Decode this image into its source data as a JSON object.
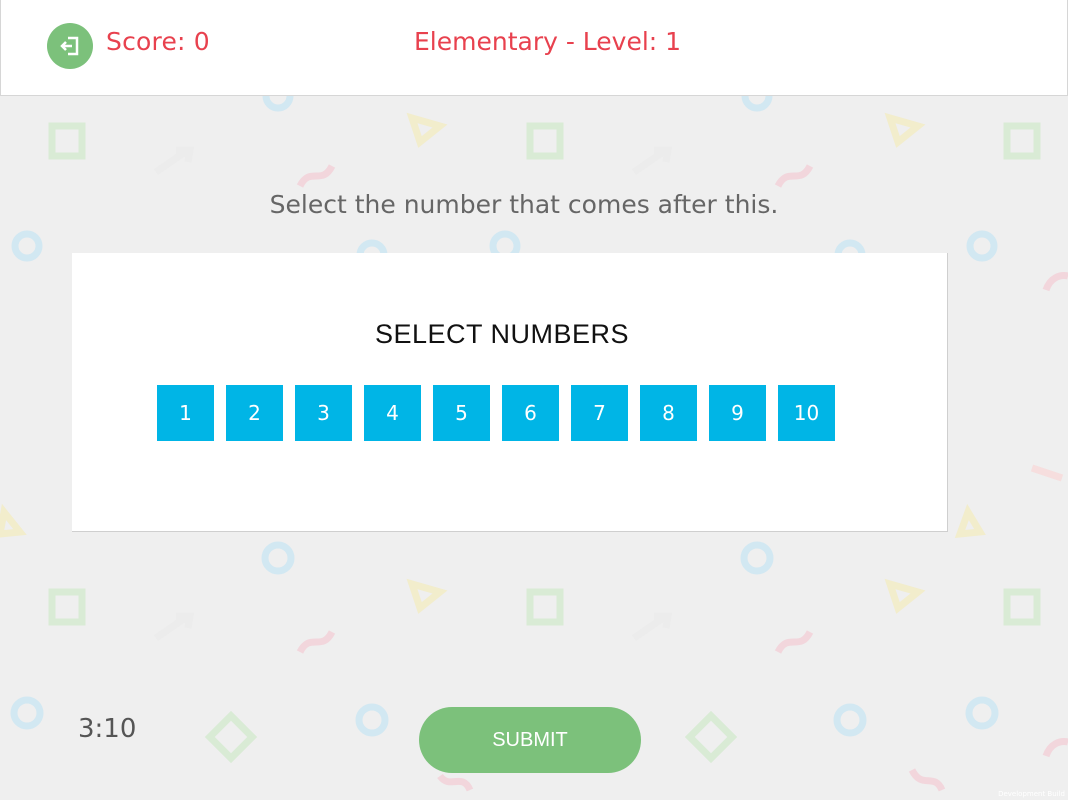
{
  "header": {
    "exit_icon": "exit-icon",
    "score_text": "Score: 0",
    "level_text": "Elementary - Level: 1"
  },
  "instruction": "Select the number that comes after this.",
  "card": {
    "title": "SELECT NUMBERS",
    "numbers": [
      "1",
      "2",
      "3",
      "4",
      "5",
      "6",
      "7",
      "8",
      "9",
      "10"
    ]
  },
  "timer": "3:10",
  "submit_label": "SUBMIT",
  "watermark": "Development Build",
  "colors": {
    "accent_green": "#7cc17b",
    "score_red": "#e8414e",
    "number_blue": "#00b5e6"
  }
}
